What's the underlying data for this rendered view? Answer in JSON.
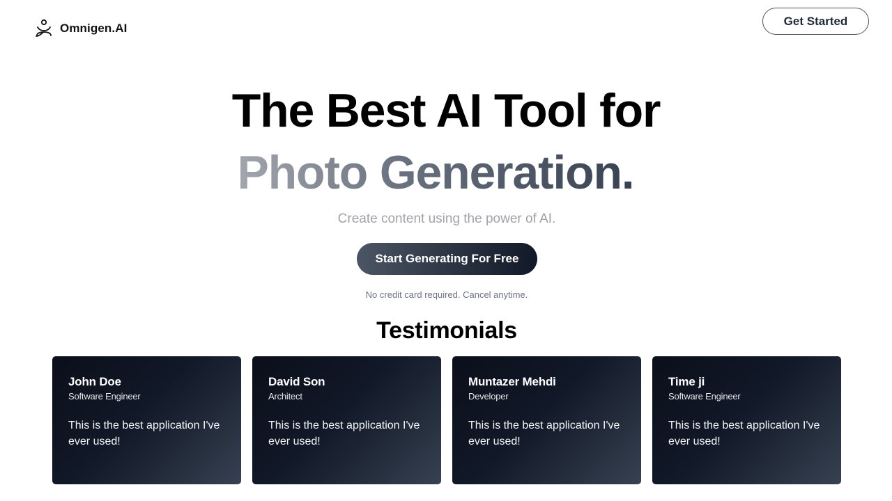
{
  "brand": {
    "name": "Omnigen.AI",
    "logo_icon": "meditation-figure-icon"
  },
  "header": {
    "cta_label": "Get Started"
  },
  "hero": {
    "line1": "The Best AI Tool for",
    "line2": "Photo Generation.",
    "subtitle": "Create content using the power of AI.",
    "cta_label": "Start Generating For Free",
    "note": "No credit card required. Cancel anytime."
  },
  "testimonials": {
    "title": "Testimonials",
    "items": [
      {
        "name": "John Doe",
        "role": "Software Engineer",
        "quote": "This is the best application I've ever used!"
      },
      {
        "name": "David Son",
        "role": "Architect",
        "quote": "This is the best application I've ever used!"
      },
      {
        "name": "Muntazer Mehdi",
        "role": "Developer",
        "quote": "This is the best application I've ever used!"
      },
      {
        "name": "Time ji",
        "role": "Software Engineer",
        "quote": "This is the best application I've ever used!"
      }
    ]
  },
  "colors": {
    "card_gradient_start": "#0b0f1a",
    "card_gradient_end": "#374151",
    "headline_gradient_start": "#a3a6ad",
    "headline_gradient_end": "#374151",
    "cta_gradient_start": "#4b5563",
    "cta_gradient_end": "#111827"
  }
}
